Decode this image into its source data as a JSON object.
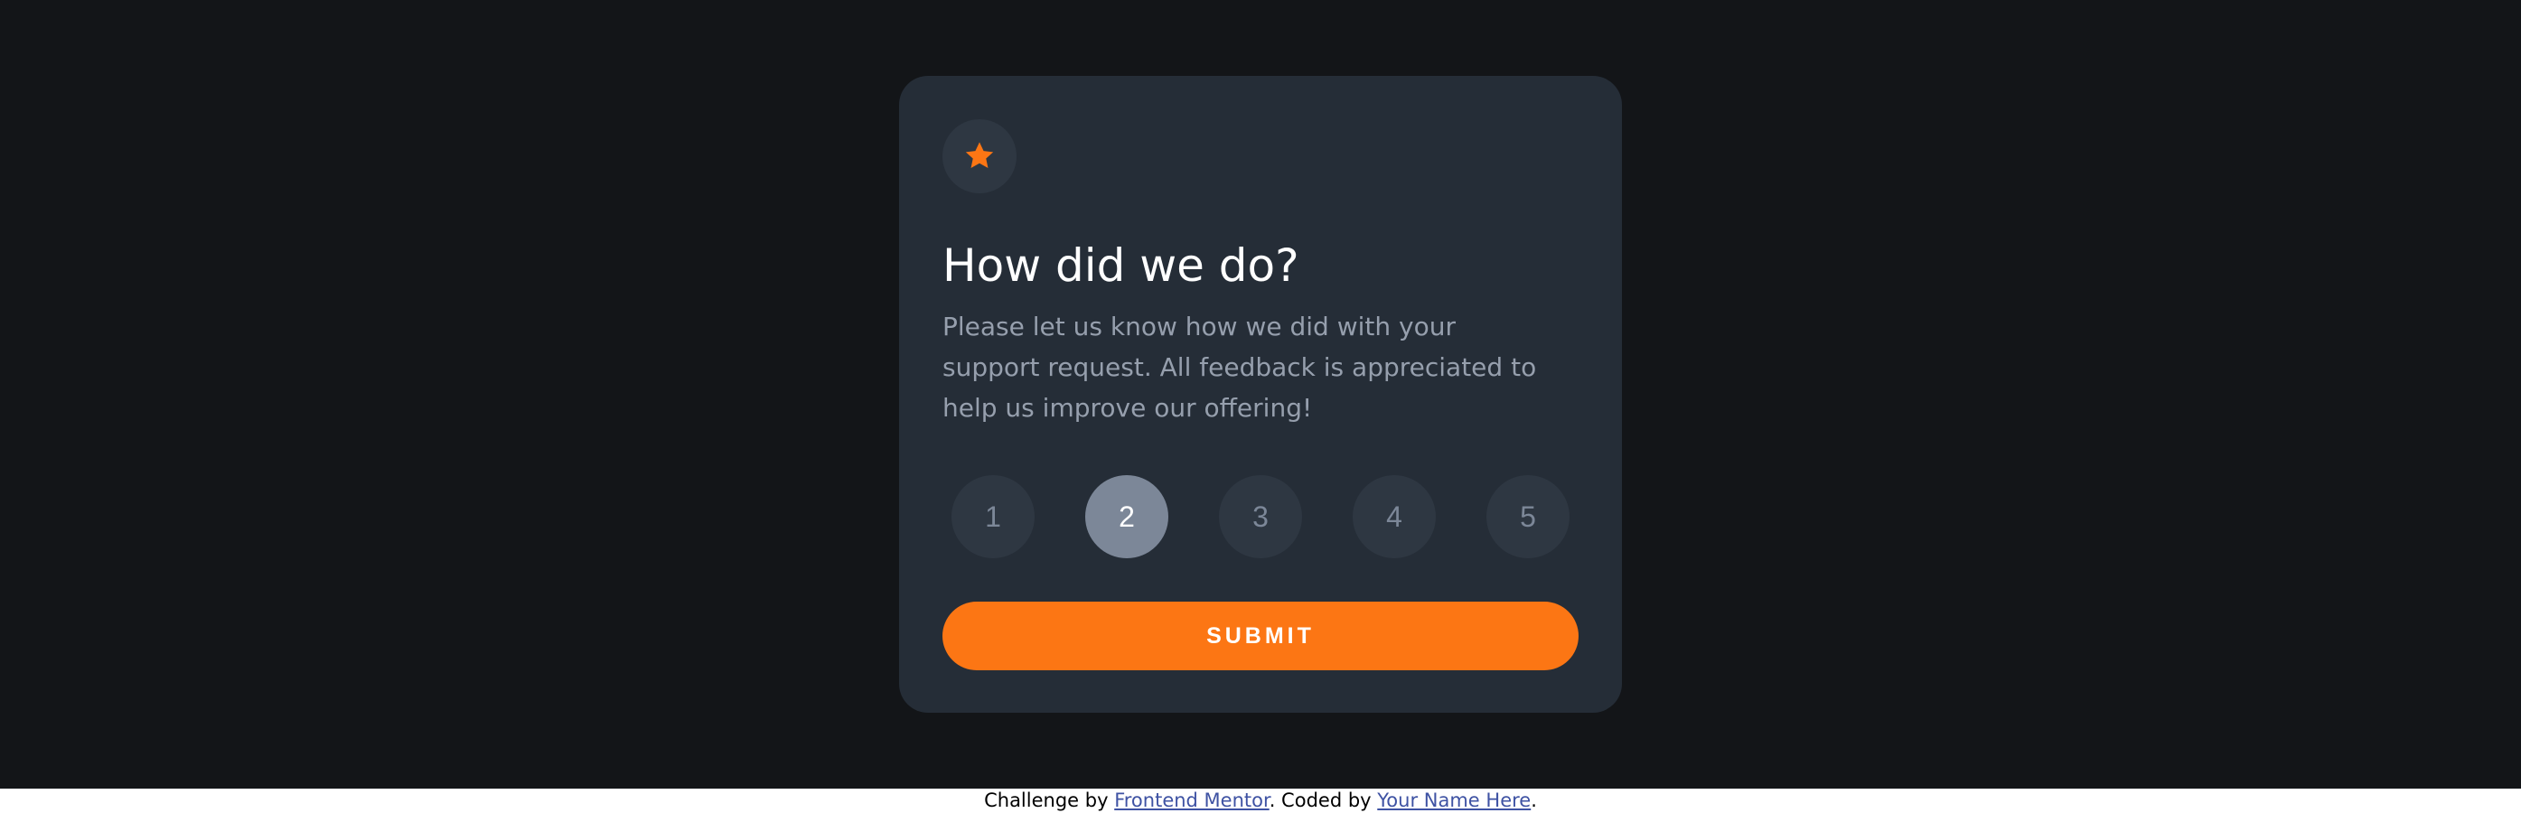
{
  "card": {
    "icon": "star-icon",
    "title": "How did we do?",
    "description": "Please let us know how we did with your support request. All feedback is appreciated to help us improve our offering!",
    "ratings": [
      "1",
      "2",
      "3",
      "4",
      "5"
    ],
    "selected_rating": "2",
    "submit_label": "SUBMIT"
  },
  "attribution": {
    "prefix": "Challenge by ",
    "link1": "Frontend Mentor",
    "middle": ". Coded by ",
    "link2": "Your Name Here",
    "suffix": "."
  },
  "colors": {
    "page_background": "#131518",
    "card_background": "#252d37",
    "accent_orange": "#fc7614",
    "rating_background": "#2e3742",
    "rating_selected_background": "#7c8798",
    "text_muted": "#969fad",
    "link": "#3e52a3"
  }
}
